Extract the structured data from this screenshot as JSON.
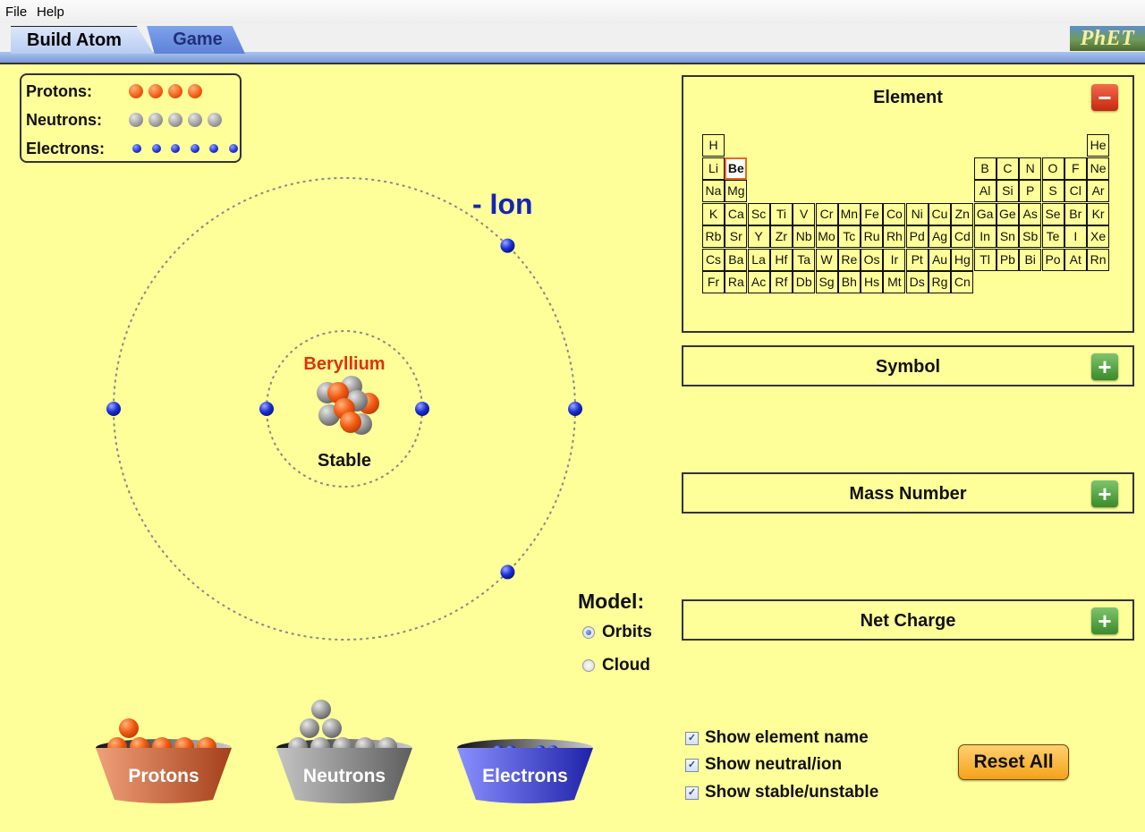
{
  "menu": {
    "file": "File",
    "help": "Help"
  },
  "tabs": [
    {
      "label": "Build Atom",
      "active": true
    },
    {
      "label": "Game",
      "active": false
    }
  ],
  "logo": "PhET",
  "legend": {
    "protons_label": "Protons:",
    "neutrons_label": "Neutrons:",
    "electrons_label": "Electrons:",
    "protons_count": 4,
    "neutrons_count": 5,
    "electrons_count": 6
  },
  "atom": {
    "element_name": "Beryllium",
    "stability": "Stable",
    "ion_label": "- Ion",
    "inner_shell_electrons": 2,
    "outer_shell_electrons": 4
  },
  "panels": {
    "element": {
      "title": "Element",
      "expanded": true,
      "toggle": "minus"
    },
    "symbol": {
      "title": "Symbol",
      "expanded": false,
      "toggle": "plus"
    },
    "mass_number": {
      "title": "Mass Number",
      "expanded": false,
      "toggle": "plus"
    },
    "net_charge": {
      "title": "Net Charge",
      "expanded": false,
      "toggle": "plus"
    }
  },
  "periodic_table": {
    "selected": "Be",
    "rows": [
      [
        [
          "H",
          0
        ],
        [
          "He",
          17
        ]
      ],
      [
        [
          "Li",
          0
        ],
        [
          "Be",
          1
        ],
        [
          "B",
          12
        ],
        [
          "C",
          13
        ],
        [
          "N",
          14
        ],
        [
          "O",
          15
        ],
        [
          "F",
          16
        ],
        [
          "Ne",
          17
        ]
      ],
      [
        [
          "Na",
          0
        ],
        [
          "Mg",
          1
        ],
        [
          "Al",
          12
        ],
        [
          "Si",
          13
        ],
        [
          "P",
          14
        ],
        [
          "S",
          15
        ],
        [
          "Cl",
          16
        ],
        [
          "Ar",
          17
        ]
      ],
      [
        [
          "K",
          0
        ],
        [
          "Ca",
          1
        ],
        [
          "Sc",
          2
        ],
        [
          "Ti",
          3
        ],
        [
          "V",
          4
        ],
        [
          "Cr",
          5
        ],
        [
          "Mn",
          6
        ],
        [
          "Fe",
          7
        ],
        [
          "Co",
          8
        ],
        [
          "Ni",
          9
        ],
        [
          "Cu",
          10
        ],
        [
          "Zn",
          11
        ],
        [
          "Ga",
          12
        ],
        [
          "Ge",
          13
        ],
        [
          "As",
          14
        ],
        [
          "Se",
          15
        ],
        [
          "Br",
          16
        ],
        [
          "Kr",
          17
        ]
      ],
      [
        [
          "Rb",
          0
        ],
        [
          "Sr",
          1
        ],
        [
          "Y",
          2
        ],
        [
          "Zr",
          3
        ],
        [
          "Nb",
          4
        ],
        [
          "Mo",
          5
        ],
        [
          "Tc",
          6
        ],
        [
          "Ru",
          7
        ],
        [
          "Rh",
          8
        ],
        [
          "Pd",
          9
        ],
        [
          "Ag",
          10
        ],
        [
          "Cd",
          11
        ],
        [
          "In",
          12
        ],
        [
          "Sn",
          13
        ],
        [
          "Sb",
          14
        ],
        [
          "Te",
          15
        ],
        [
          "I",
          16
        ],
        [
          "Xe",
          17
        ]
      ],
      [
        [
          "Cs",
          0
        ],
        [
          "Ba",
          1
        ],
        [
          "La",
          2
        ],
        [
          "Hf",
          3
        ],
        [
          "Ta",
          4
        ],
        [
          "W",
          5
        ],
        [
          "Re",
          6
        ],
        [
          "Os",
          7
        ],
        [
          "Ir",
          8
        ],
        [
          "Pt",
          9
        ],
        [
          "Au",
          10
        ],
        [
          "Hg",
          11
        ],
        [
          "Tl",
          12
        ],
        [
          "Pb",
          13
        ],
        [
          "Bi",
          14
        ],
        [
          "Po",
          15
        ],
        [
          "At",
          16
        ],
        [
          "Rn",
          17
        ]
      ],
      [
        [
          "Fr",
          0
        ],
        [
          "Ra",
          1
        ],
        [
          "Ac",
          2
        ],
        [
          "Rf",
          3
        ],
        [
          "Db",
          4
        ],
        [
          "Sg",
          5
        ],
        [
          "Bh",
          6
        ],
        [
          "Hs",
          7
        ],
        [
          "Mt",
          8
        ],
        [
          "Ds",
          9
        ],
        [
          "Rg",
          10
        ],
        [
          "Cn",
          11
        ]
      ]
    ]
  },
  "model": {
    "label": "Model:",
    "options": [
      {
        "label": "Orbits",
        "selected": true
      },
      {
        "label": "Cloud",
        "selected": false
      }
    ]
  },
  "buckets": [
    {
      "label": "Protons",
      "color": "#c8612f"
    },
    {
      "label": "Neutrons",
      "color": "#8a8a8a"
    },
    {
      "label": "Electrons",
      "color": "#3d44d6"
    }
  ],
  "checkboxes": [
    {
      "label": "Show element name",
      "checked": true
    },
    {
      "label": "Show neutral/ion",
      "checked": true
    },
    {
      "label": "Show stable/unstable",
      "checked": true
    }
  ],
  "reset_label": "Reset All",
  "colors": {
    "background": "#ffff99",
    "element_name": "#e0310c",
    "ion_label": "#1425b8",
    "proton": "#f25a12",
    "neutron": "#9a9a9a",
    "electron": "#1a2fd8"
  }
}
